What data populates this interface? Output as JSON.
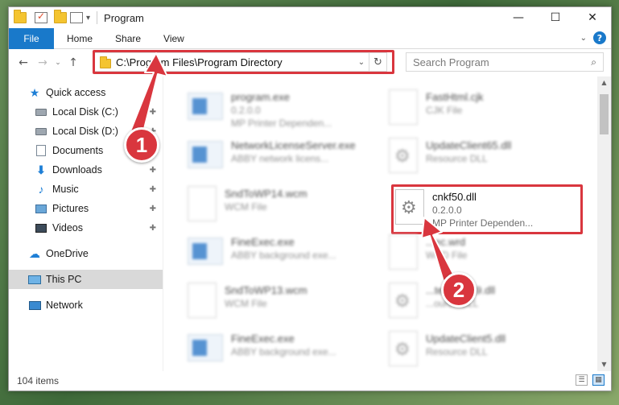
{
  "window": {
    "title": "Program"
  },
  "ribbon": {
    "file": "File",
    "tabs": [
      "Home",
      "Share",
      "View"
    ],
    "help": "?"
  },
  "controls": {
    "minimize": "—",
    "maximize": "☐",
    "close": "✕"
  },
  "nav": {
    "back": "←",
    "forward": "→",
    "recent": "⌄",
    "up": "↑",
    "address": "C:\\Program Files\\Program Directory",
    "dropdown": "⌄",
    "refresh": "↻",
    "search_placeholder": "Search Program",
    "search_icon": "⌕"
  },
  "sidebar": {
    "items": [
      {
        "label": "Quick access",
        "icon": "star-icon"
      },
      {
        "label": "Local Disk (C:)",
        "icon": "disk-icon",
        "pinned": true
      },
      {
        "label": "Local Disk (D:)",
        "icon": "disk-icon",
        "pinned": true
      },
      {
        "label": "Documents",
        "icon": "documents-icon",
        "pinned": true
      },
      {
        "label": "Downloads",
        "icon": "downloads-icon",
        "pinned": true
      },
      {
        "label": "Music",
        "icon": "music-icon",
        "pinned": true
      },
      {
        "label": "Pictures",
        "icon": "pictures-icon",
        "pinned": true
      },
      {
        "label": "Videos",
        "icon": "videos-icon",
        "pinned": true
      },
      {
        "label": "OneDrive",
        "icon": "onedrive-icon"
      },
      {
        "label": "This PC",
        "icon": "this-pc-icon",
        "selected": true
      },
      {
        "label": "Network",
        "icon": "network-icon"
      }
    ],
    "pin_glyph": "📌"
  },
  "files": [
    {
      "name": "program.exe",
      "sub1": "0.2.0.0",
      "sub2": "MP Printer Dependen...",
      "icon": "exe-file-icon"
    },
    {
      "name": "FastHtml.cjk",
      "sub1": "CJK File",
      "sub2": "",
      "icon": "blank-file-icon"
    },
    {
      "name": "NetworkLicenseServer.exe",
      "sub1": "ABBY network licens...",
      "sub2": "",
      "icon": "exe-file-icon"
    },
    {
      "name": "UpdateClient65.dll",
      "sub1": "Resource DLL",
      "sub2": "",
      "icon": "dll-file-icon"
    },
    {
      "name": "SndToWP14.wcm",
      "sub1": "WCM File",
      "sub2": "",
      "icon": "blank-file-icon"
    },
    {
      "name": "cnkf50.dll",
      "sub1": "0.2.0.0",
      "sub2": "MP Printer Dependen...",
      "icon": "dll-file-icon"
    },
    {
      "name": "FineExec.exe",
      "sub1": "ABBY background exe...",
      "sub2": "",
      "icon": "exe-file-icon"
    },
    {
      "name": "...ec.wrd",
      "sub1": "WRD File",
      "sub2": "",
      "icon": "blank-file-icon"
    },
    {
      "name": "SndToWP13.wcm",
      "sub1": "WCM File",
      "sub2": "",
      "icon": "blank-file-icon"
    },
    {
      "name": "...teClient19.dll",
      "sub1": "...ource DLL",
      "sub2": "",
      "icon": "dll-file-icon"
    },
    {
      "name": "FineExec.exe",
      "sub1": "ABBY background exe...",
      "sub2": "",
      "icon": "exe-file-icon"
    },
    {
      "name": "UpdateClient5.dll",
      "sub1": "Resource DLL",
      "sub2": "",
      "icon": "dll-file-icon"
    }
  ],
  "status": {
    "item_count": "104 items"
  },
  "annotations": {
    "step1": "1",
    "step2": "2",
    "color": "#d9363e"
  }
}
